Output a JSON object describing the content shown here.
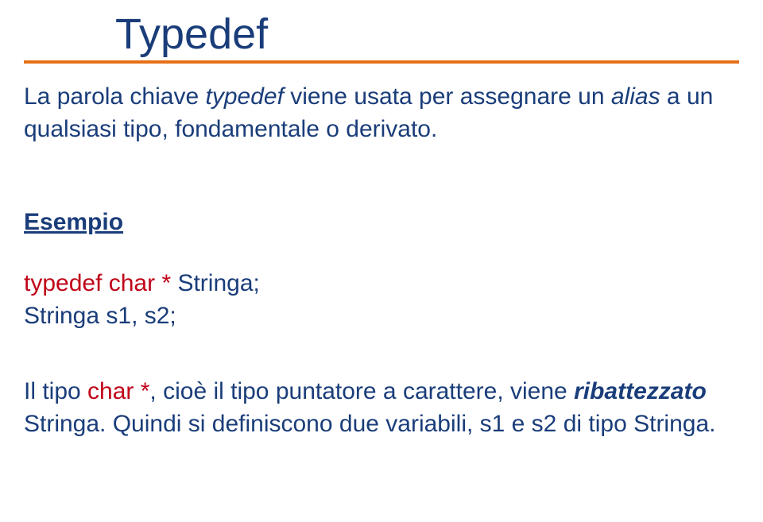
{
  "title": "Typedef",
  "intro": {
    "t1": "La parola chiave ",
    "kw1": "typedef",
    "t2": " viene usata per assegnare un ",
    "kw2": "alias",
    "t3": " a un qualsiasi tipo, fondamentale o derivato."
  },
  "example_label": "Esempio",
  "code": {
    "l1": {
      "a": "typedef char *",
      "b": " Stringa;"
    },
    "l2": "Stringa s1, s2;"
  },
  "expl": {
    "t1": "Il tipo ",
    "kw1": "char *",
    "t2": ", cioè il tipo puntatore a carattere, viene ",
    "kw2": "ribattezzato",
    "t3": " Stringa. Quindi si definiscono due variabili, s1 e s2 di tipo Stringa."
  }
}
